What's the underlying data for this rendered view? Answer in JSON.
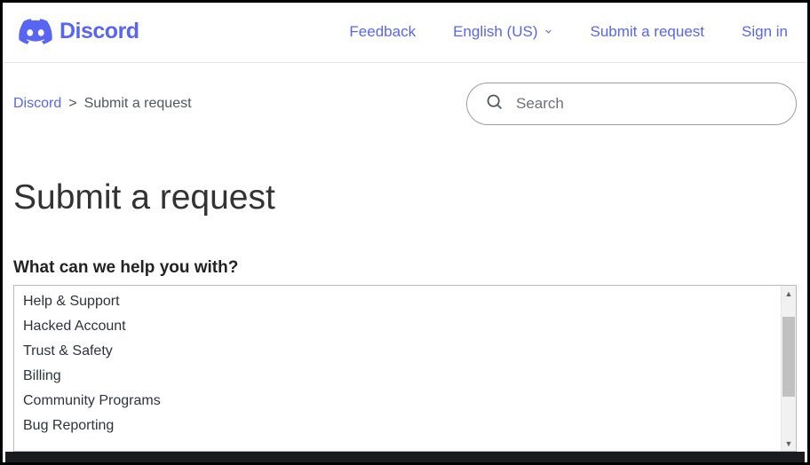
{
  "brand": {
    "name": "Discord"
  },
  "nav": {
    "feedback": "Feedback",
    "language": "English (US)",
    "submit": "Submit a request",
    "signin": "Sign in"
  },
  "breadcrumb": {
    "root": "Discord",
    "current": "Submit a request"
  },
  "search": {
    "placeholder": "Search"
  },
  "page": {
    "title": "Submit a request",
    "field_label": "What can we help you with?"
  },
  "options": [
    "Help & Support",
    "Hacked Account",
    "Trust & Safety",
    "Billing",
    "Community Programs",
    "Bug Reporting"
  ]
}
